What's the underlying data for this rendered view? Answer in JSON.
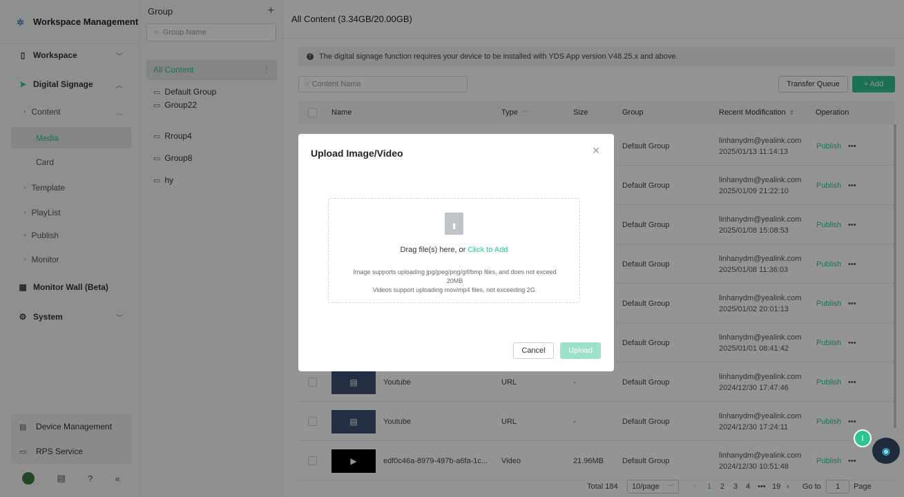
{
  "sidebar": {
    "header": "Workspace Management",
    "workspace": "Workspace",
    "digital_signage": "Digital Signage",
    "content": "Content",
    "media": "Media",
    "card": "Card",
    "template": "Template",
    "playlist": "PlayList",
    "publish": "Publish",
    "monitor": "Monitor",
    "monitor_wall": "Monitor Wall (Beta)",
    "system": "System",
    "device_management": "Device Management",
    "rps_service": "RPS Service"
  },
  "groups": {
    "title": "Group",
    "add": "+",
    "search_placeholder": "Group Name",
    "items": [
      "All Content",
      "Default Group",
      "Group22",
      "Rroup4",
      "Group8",
      "hy"
    ]
  },
  "main": {
    "title": "All Content (3.34GB/20.00GB)",
    "notice": "The digital signage function requires your device to be installed with YDS App version V48.25.x and above.",
    "search_placeholder": "Content Name",
    "transfer_queue": "Transfer Queue",
    "add": "+ Add",
    "columns": {
      "name": "Name",
      "type": "Type",
      "size": "Size",
      "group": "Group",
      "recent": "Recent Modification",
      "operation": "Operation"
    },
    "rows": [
      {
        "name": "",
        "type": "",
        "size": "",
        "group": "Default Group",
        "user": "linhanydm@yealink.com",
        "time": "2025/01/13 11:14:13",
        "op": "Publish"
      },
      {
        "name": "",
        "type": "",
        "size": "",
        "group": "Default Group",
        "user": "linhanydm@yealink.com",
        "time": "2025/01/09 21:22:10",
        "op": "Publish"
      },
      {
        "name": "",
        "type": "",
        "size": "",
        "group": "Default Group",
        "user": "linhanydm@yealink.com",
        "time": "2025/01/08 15:08:53",
        "op": "Publish"
      },
      {
        "name": "",
        "type": "",
        "size": "",
        "group": "Default Group",
        "user": "linhanydm@yealink.com",
        "time": "2025/01/08 11:36:03",
        "op": "Publish"
      },
      {
        "name": "",
        "type": "",
        "size": "",
        "group": "Default Group",
        "user": "linhanydm@yealink.com",
        "time": "2025/01/02 20:01:13",
        "op": "Publish"
      },
      {
        "name": "",
        "type": "",
        "size": "",
        "group": "Default Group",
        "user": "linhanydm@yealink.com",
        "time": "2025/01/01 08:41:42",
        "op": "Publish"
      },
      {
        "name": "Youtube",
        "type": "URL",
        "size": "-",
        "group": "Default Group",
        "user": "linhanydm@yealink.com",
        "time": "2024/12/30 17:47:46",
        "op": "Publish"
      },
      {
        "name": "Youtube",
        "type": "URL",
        "size": "-",
        "group": "Default Group",
        "user": "linhanydm@yealink.com",
        "time": "2024/12/30 17:24:11",
        "op": "Publish"
      },
      {
        "name": "edf0c46a-8979-497b-a6fa-1c...",
        "type": "Video",
        "size": "21.96MB",
        "group": "Default Group",
        "user": "linhanydm@yealink.com",
        "time": "2024/12/30 10:51:48",
        "op": "Publish"
      }
    ],
    "pager": {
      "total": "Total 184",
      "page_size": "10/page",
      "pages": [
        "1",
        "2",
        "3",
        "4",
        "19"
      ],
      "goto": "Go to",
      "goto_value": "1",
      "page": "Page"
    }
  },
  "modal": {
    "title": "Upload Image/Video",
    "drag_text": "Drag file(s) here, or ",
    "click_to_add": "Click to Add",
    "hint1": "Image supports uploading jpg/jpeg/png/gif/bmp files, and does not exceed 20MB",
    "hint2": "Videos support uploading mov/mp4 files, not exceeding 2G.",
    "cancel": "Cancel",
    "upload": "Upload"
  },
  "assistant": {
    "badge": "I"
  },
  "colors": {
    "accent": "#2ec38f"
  }
}
